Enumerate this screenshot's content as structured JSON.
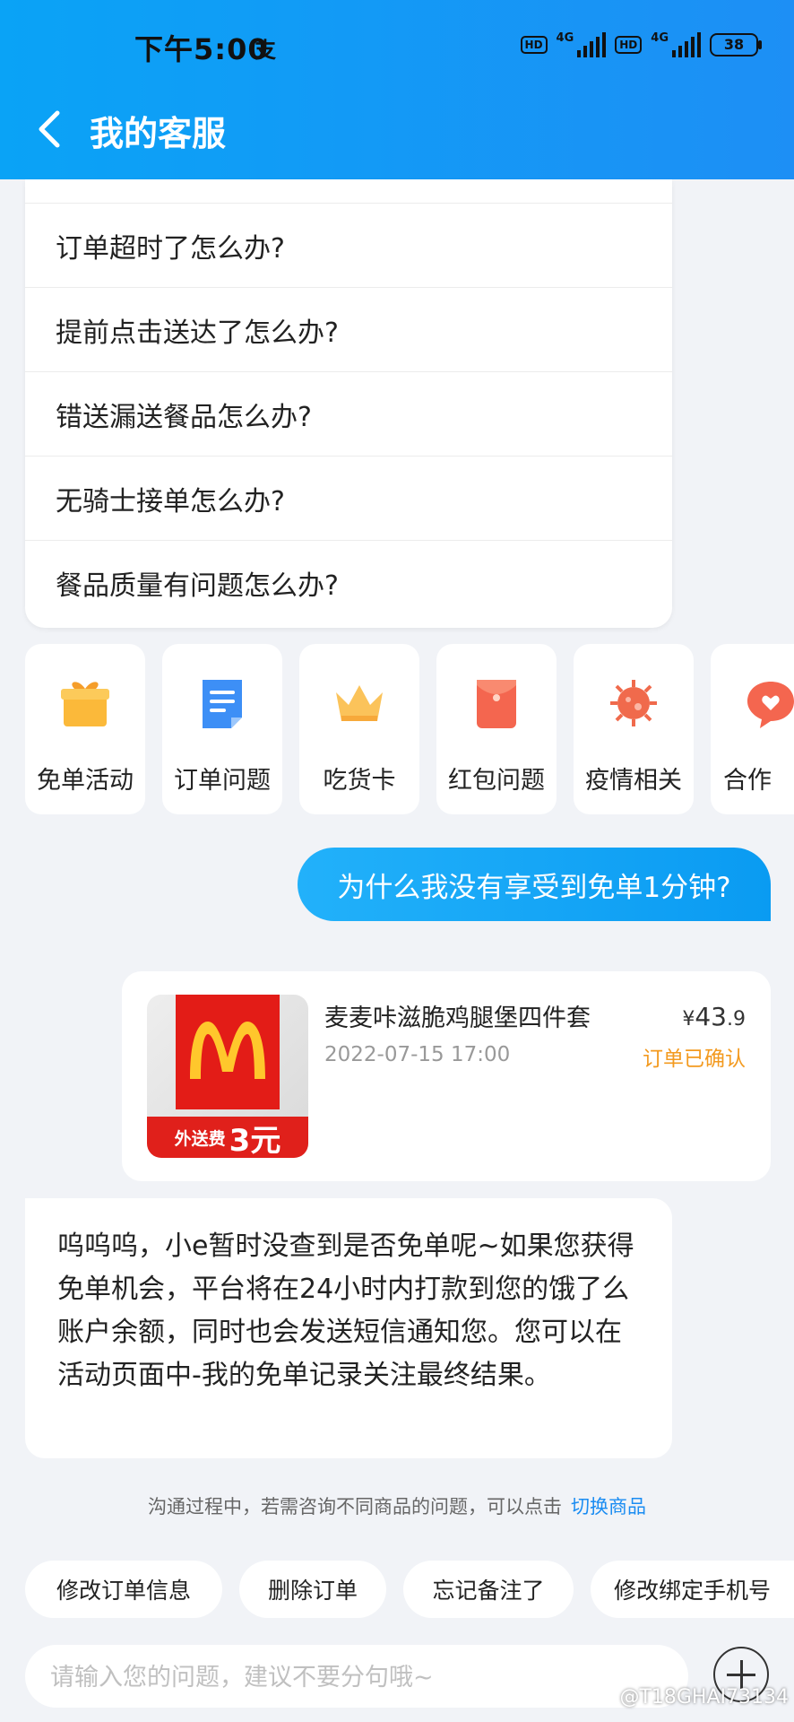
{
  "status_bar": {
    "time": "下午5:00",
    "alipay_glyph": "支",
    "hd1": "HD",
    "net1": "4G",
    "hd2": "HD",
    "net2": "4G",
    "battery": "38"
  },
  "header": {
    "title": "我的客服",
    "back_icon": "chevron-left-icon"
  },
  "faq": {
    "items": [
      "订单超时了怎么办?",
      "提前点击送达了怎么办?",
      "错送漏送餐品怎么办?",
      "无骑士接单怎么办?",
      "餐品质量有问题怎么办?"
    ]
  },
  "categories": [
    {
      "label": "免单活动",
      "icon": "gift-icon",
      "color": "#fbb93a"
    },
    {
      "label": "订单问题",
      "icon": "document-icon",
      "color": "#3d8ff6"
    },
    {
      "label": "吃货卡",
      "icon": "crown-icon",
      "color": "#fbc35a"
    },
    {
      "label": "红包问题",
      "icon": "red-envelope-icon",
      "color": "#f4664f"
    },
    {
      "label": "疫情相关",
      "icon": "virus-icon",
      "color": "#f06a4c"
    },
    {
      "label": "合作",
      "icon": "chat-heart-icon",
      "color": "#f4664f"
    }
  ],
  "user_message": "为什么我没有享受到免单1分钟?",
  "order": {
    "name": "麦麦咔滋脆鸡腿堡四件套",
    "date": "2022-07-15 17:00",
    "price_symbol": "¥",
    "price_int": "43",
    "price_dec": ".9",
    "status": "订单已确认",
    "thumb_fee_label": "外送费",
    "thumb_fee_value": "3元",
    "thumb_logo": "mcdonalds-logo-icon"
  },
  "bot_message": "呜呜呜，小e暂时没查到是否免单呢~如果您获得免单机会，平台将在24小时内打款到您的饿了么账户余额，同时也会发送短信通知您。您可以在活动页面中-我的免单记录关注最终结果。",
  "hint": {
    "text": "沟通过程中，若需咨询不同商品的问题，可以点击",
    "link": "切换商品"
  },
  "chips": [
    "修改订单信息",
    "删除订单",
    "忘记备注了",
    "修改绑定手机号"
  ],
  "input": {
    "placeholder": "请输入您的问题，建议不要分句哦~"
  },
  "watermark": "@T18GHAI73134"
}
